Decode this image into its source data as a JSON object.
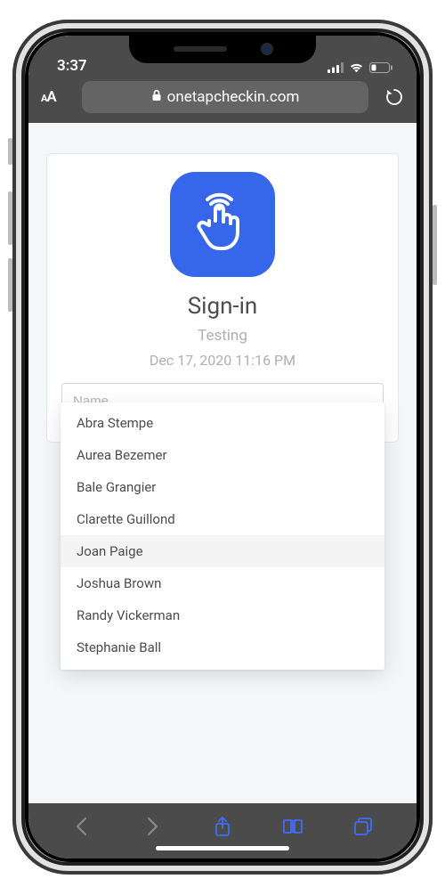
{
  "status": {
    "time": "3:37"
  },
  "browser": {
    "url": "onetapcheckin.com"
  },
  "signin": {
    "title": "Sign-in",
    "subtitle": "Testing",
    "timestamp": "Dec 17, 2020 11:16 PM",
    "name_placeholder": "Name",
    "highlighted_index": 4,
    "suggestions": [
      "Abra Stempe",
      "Aurea Bezemer",
      "Bale Grangier",
      "Clarette Guillond",
      "Joan Paige",
      "Joshua Brown",
      "Randy Vickerman",
      "Stephanie Ball"
    ]
  },
  "colors": {
    "accent": "#3667ea",
    "ios_blue": "#3f6ef5"
  }
}
